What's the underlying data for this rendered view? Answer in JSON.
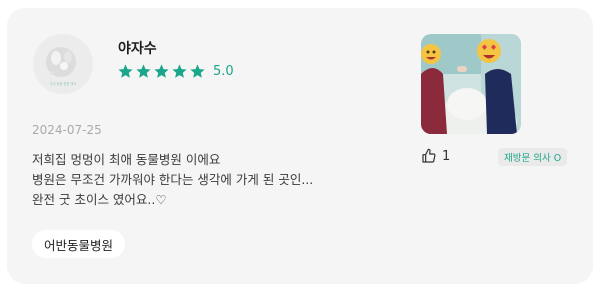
{
  "review": {
    "username": "야자수",
    "rating_value": 5,
    "rating_text": "5.0",
    "date": "2024-07-25",
    "text_lines": [
      "저희집 멍멍이 최애 동물병원 이에요",
      "병원은 무조건 가까워야 한다는 생각에 가게 된 곳인...",
      "완전 굿 초이스 였어요..♡"
    ],
    "hospital_tag": "어반동물병원",
    "likes": "1",
    "revisit_badge": "재방문 의사 O",
    "avatar_caption": "우리 동물 병원 체크"
  },
  "colors": {
    "accent": "#1aa68a",
    "card_bg": "#f5f5f5",
    "star": "#1aa68a"
  },
  "icons": {
    "star": "star-icon",
    "like": "thumbs-up-icon"
  }
}
